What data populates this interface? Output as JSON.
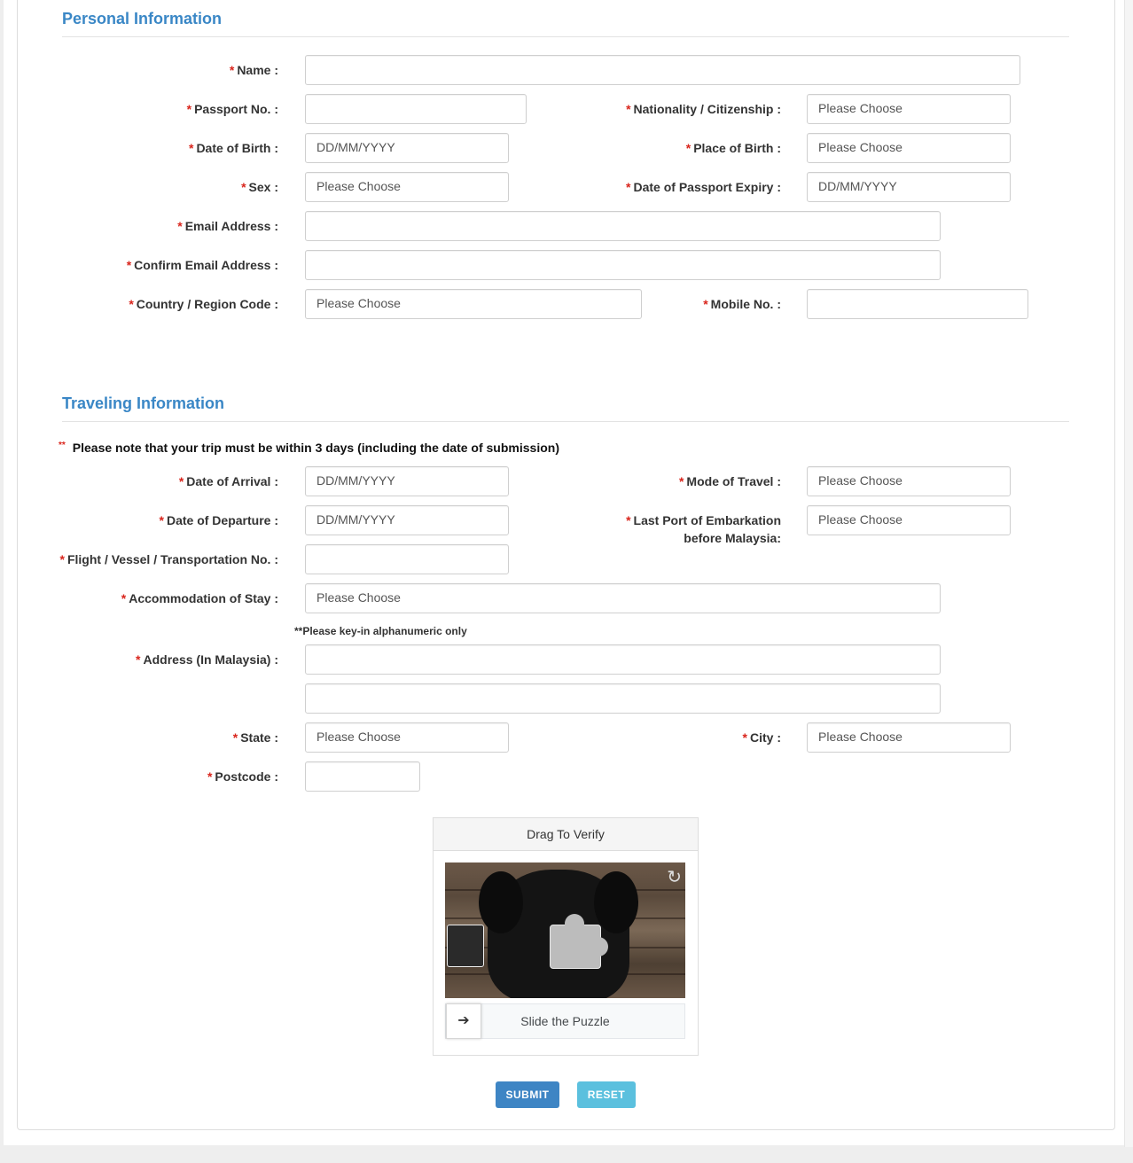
{
  "personal": {
    "title": "Personal Information",
    "name": {
      "label": "Name :",
      "value": ""
    },
    "passport": {
      "label": "Passport No. :",
      "value": ""
    },
    "nationality": {
      "label": "Nationality / Citizenship :",
      "value": "Please Choose"
    },
    "dob": {
      "label": "Date of Birth :",
      "placeholder": "DD/MM/YYYY"
    },
    "pob": {
      "label": "Place of Birth :",
      "value": "Please Choose"
    },
    "sex": {
      "label": "Sex :",
      "value": "Please Choose"
    },
    "passport_expiry": {
      "label": "Date of Passport Expiry :",
      "placeholder": "DD/MM/YYYY"
    },
    "email": {
      "label": "Email Address :",
      "value": ""
    },
    "confirm_email": {
      "label": "Confirm Email Address :",
      "value": ""
    },
    "country_code": {
      "label": "Country / Region Code :",
      "value": "Please Choose"
    },
    "mobile": {
      "label": "Mobile No. :",
      "value": ""
    }
  },
  "traveling": {
    "title": "Traveling Information",
    "note_stars": "**",
    "note": "Please note that your trip must be within 3 days (including the date of submission)",
    "arrival": {
      "label": "Date of Arrival :",
      "placeholder": "DD/MM/YYYY"
    },
    "mode": {
      "label": "Mode of Travel :",
      "value": "Please Choose"
    },
    "departure": {
      "label": "Date of Departure :",
      "placeholder": "DD/MM/YYYY"
    },
    "last_port": {
      "label_line1": "Last Port of Embarkation",
      "label_line2": "before Malaysia:",
      "value": "Please Choose"
    },
    "flight": {
      "label": "Flight / Vessel / Transportation No. :",
      "value": ""
    },
    "accommodation": {
      "label": "Accommodation of Stay :",
      "value": "Please Choose"
    },
    "alnum_note": "**Please key-in alphanumeric only",
    "address": {
      "label": "Address (In Malaysia) :",
      "line1": "",
      "line2": ""
    },
    "state": {
      "label": "State :",
      "value": "Please Choose"
    },
    "city": {
      "label": "City :",
      "value": "Please Choose"
    },
    "postcode": {
      "label": "Postcode :",
      "value": ""
    }
  },
  "captcha": {
    "header": "Drag To Verify",
    "slider_text": "Slide the Puzzle",
    "arrow": "➔",
    "refresh": "↻"
  },
  "actions": {
    "submit": "SUBMIT",
    "reset": "RESET"
  },
  "colors": {
    "accent": "#3a87c6",
    "required": "#d9251c",
    "submit": "#3e85c4",
    "reset": "#5bc0de"
  }
}
